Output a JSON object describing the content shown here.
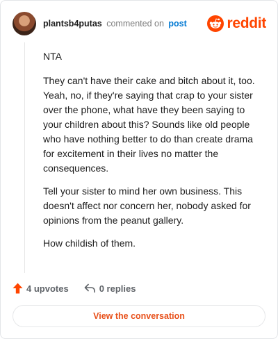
{
  "comment": {
    "username": "plantsb4putas",
    "action_text": "commented on",
    "post_link": "post",
    "paragraphs": [
      "NTA",
      "They can't have their cake and bitch about it, too. Yeah, no, if they're saying that crap to your sister over the phone, what have they been saying to your children about this? Sounds like old people who have nothing better to do than create drama for excitement in their lives no matter the consequences.",
      "Tell your sister to mind her own business. This doesn't affect nor concern her, nobody asked for opinions from the peanut gallery.",
      "How childish of them."
    ]
  },
  "brand": {
    "wordmark": "reddit",
    "icon": "reddit-snoo-icon",
    "color": "#ff4500"
  },
  "actions": {
    "upvotes_label": "4 upvotes",
    "upvote_icon": "upvote-arrow-icon",
    "upvote_color": "#ff4500",
    "replies_label": "0 replies",
    "reply_icon": "reply-arrow-icon"
  },
  "view_conversation_label": "View the conversation"
}
